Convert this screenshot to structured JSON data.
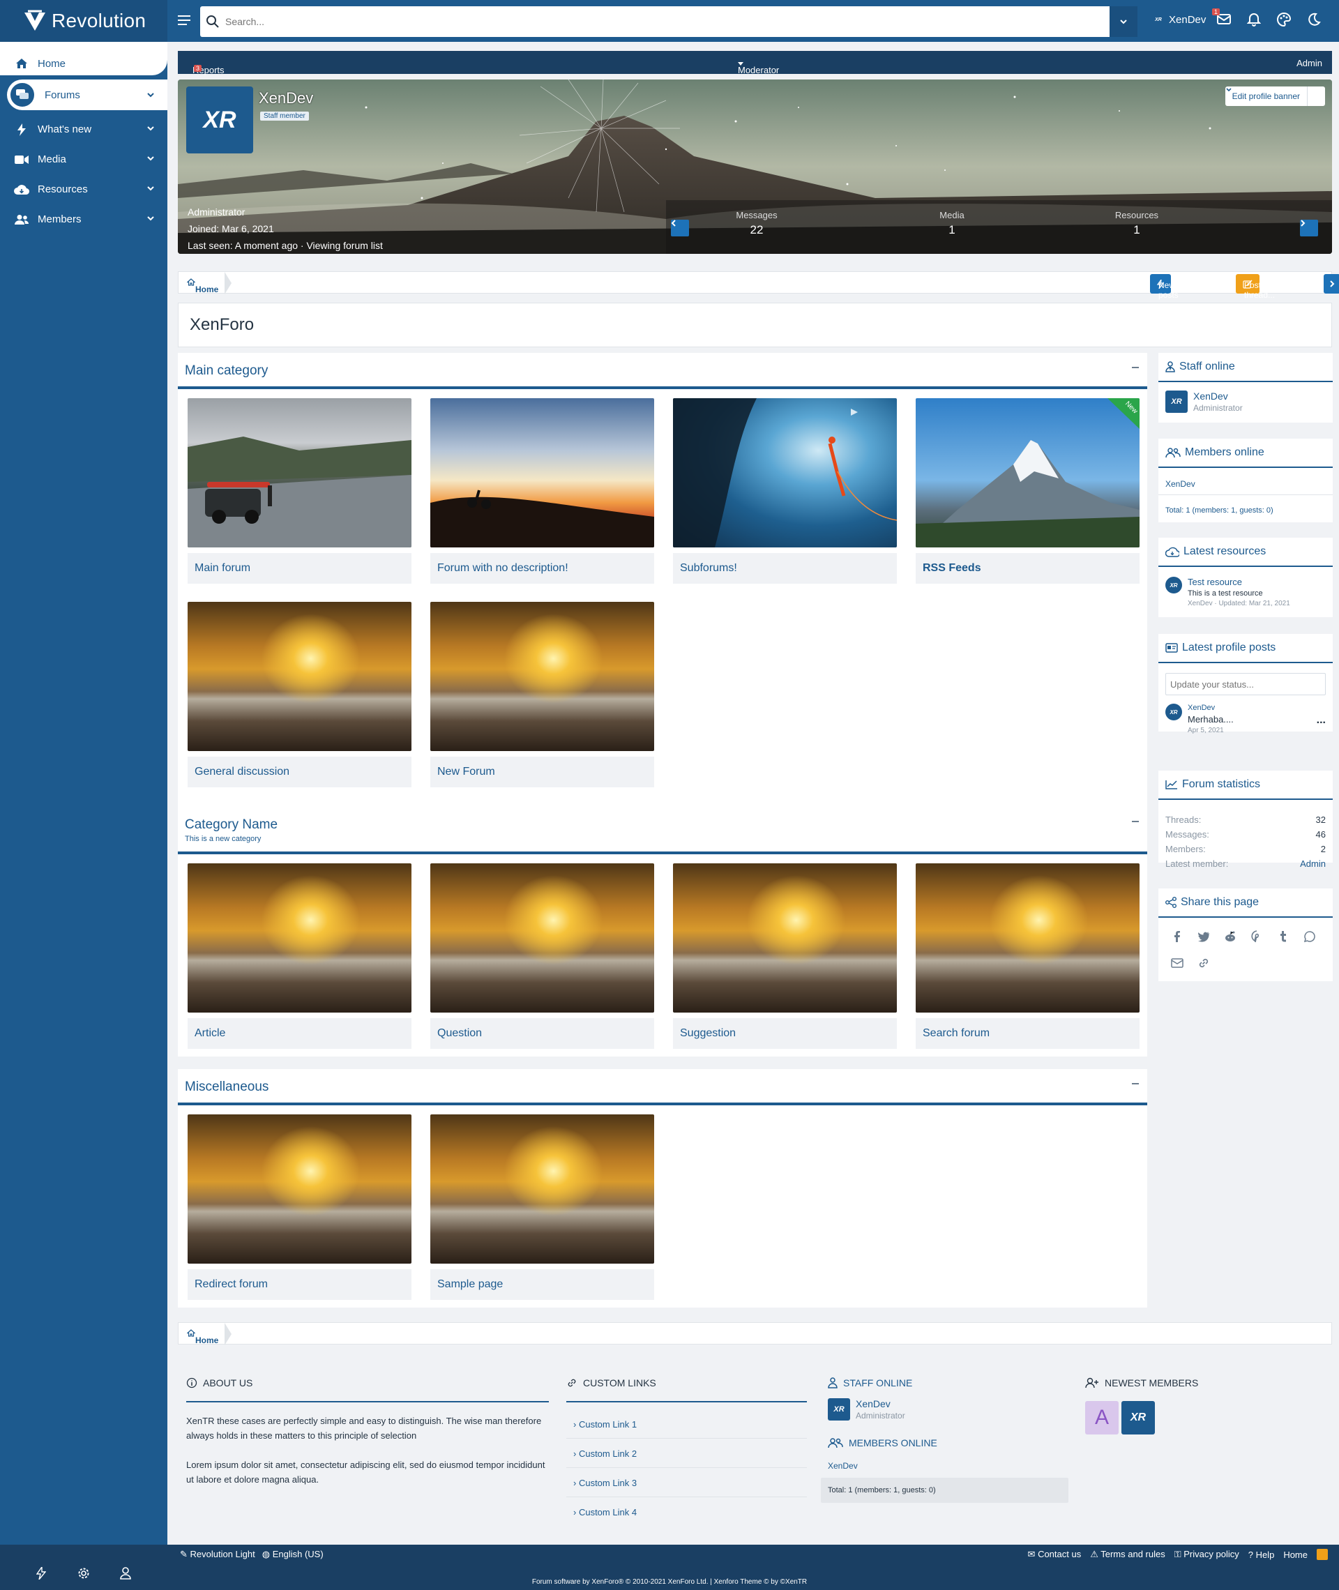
{
  "brand": {
    "name": "Revolution"
  },
  "search": {
    "placeholder": "Search..."
  },
  "top": {
    "user": "XenDev",
    "conv_badge": "1"
  },
  "nav": {
    "items": [
      {
        "label": "Home"
      },
      {
        "label": "Forums"
      },
      {
        "label": "What's new"
      },
      {
        "label": "Media"
      },
      {
        "label": "Resources"
      },
      {
        "label": "Members"
      }
    ]
  },
  "modbar": {
    "reports": "Reports",
    "reports_count": "3",
    "moderator": "Moderator",
    "admin": "Admin"
  },
  "profile": {
    "name": "XenDev",
    "staff": "Staff member",
    "role": "Administrator",
    "joined_label": "Joined:",
    "joined": "Mar 6, 2021",
    "last_seen_label": "Last seen:",
    "last_seen": "A moment ago · Viewing forum list",
    "edit_banner": "Edit profile banner",
    "stats": [
      {
        "label": "Messages",
        "value": "22"
      },
      {
        "label": "Media",
        "value": "1"
      },
      {
        "label": "Resources",
        "value": "1"
      }
    ]
  },
  "breadcrumb": {
    "home": "Home"
  },
  "actions": {
    "new_posts": "New posts",
    "post_thread": "Post thread..."
  },
  "page_title": "XenForo",
  "categories": [
    {
      "title": "Main category",
      "desc": "",
      "nodes": [
        "Main forum",
        "Forum with no description!",
        "Subforums!",
        "RSS Feeds",
        "General discussion",
        "New Forum"
      ],
      "new_tag": "New"
    },
    {
      "title": "Category Name",
      "desc": "This is a new category",
      "nodes": [
        "Article",
        "Question",
        "Suggestion",
        "Search forum"
      ]
    },
    {
      "title": "Miscellaneous",
      "desc": "",
      "nodes": [
        "Redirect forum",
        "Sample page"
      ]
    }
  ],
  "side": {
    "staff": {
      "title": "Staff online",
      "user": "XenDev",
      "role": "Administrator"
    },
    "members": {
      "title": "Members online",
      "user": "XenDev",
      "total": "Total: 1 (members: 1, guests: 0)"
    },
    "resources": {
      "title": "Latest resources",
      "name": "Test resource",
      "desc": "This is a test resource",
      "meta": "XenDev · Updated: Mar 21, 2021"
    },
    "profile_posts": {
      "title": "Latest profile posts",
      "placeholder": "Update your status...",
      "user": "XenDev",
      "text": "Merhaba....",
      "date": "Apr 5, 2021",
      "more": "..."
    },
    "stats": {
      "title": "Forum statistics",
      "rows": [
        {
          "k": "Threads:",
          "v": "32"
        },
        {
          "k": "Messages:",
          "v": "46"
        },
        {
          "k": "Members:",
          "v": "2"
        },
        {
          "k": "Latest member:",
          "v": "Admin"
        }
      ]
    },
    "share": {
      "title": "Share this page"
    }
  },
  "footer": {
    "about": {
      "title": "ABOUT US",
      "p1": "XenTR these cases are perfectly simple and easy to distinguish. The wise man therefore always holds in these matters to this principle of selection",
      "p2": "Lorem ipsum dolor sit amet, consectetur adipiscing elit, sed do eiusmod tempor incididunt ut labore et dolore magna aliqua."
    },
    "links": {
      "title": "CUSTOM LINKS",
      "items": [
        "Custom Link 1",
        "Custom Link 2",
        "Custom Link 3",
        "Custom Link 4"
      ]
    },
    "staff": {
      "title": "STAFF ONLINE",
      "user": "XenDev",
      "role": "Administrator",
      "members_title": "MEMBERS ONLINE",
      "member": "XenDev",
      "total": "Total: 1 (members: 1, guests: 0)"
    },
    "newest": {
      "title": "NEWEST MEMBERS",
      "initial": "A"
    }
  },
  "bottom": {
    "style": "Revolution Light",
    "lang": "English (US)",
    "contact": "Contact us",
    "terms": "Terms and rules",
    "privacy": "Privacy policy",
    "help": "Help",
    "home": "Home",
    "copyright": "Forum software by XenForo® © 2010-2021 XenForo Ltd. | Xenforo Theme © by ©XenTR"
  },
  "colors": {
    "primary": "#1d5a8e",
    "dark": "#1a3f63",
    "accent": "#f0a019",
    "bg": "#f0f2f5"
  }
}
